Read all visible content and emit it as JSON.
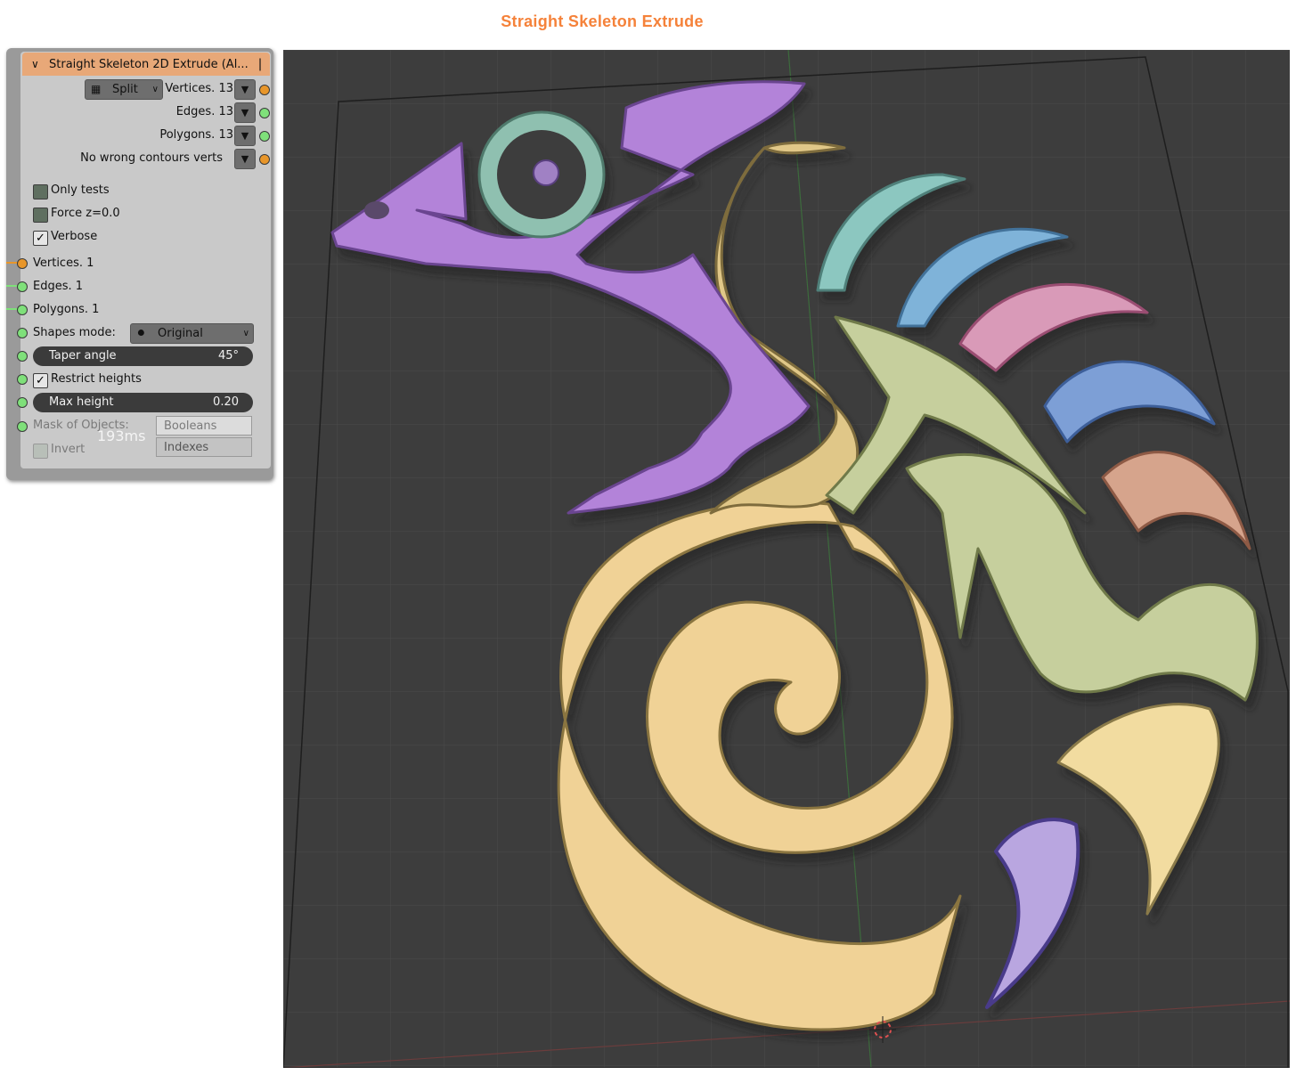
{
  "page": {
    "title": "Straight Skeleton Extrude",
    "title_color": "#f5823a"
  },
  "node": {
    "header_title": "Straight Skeleton 2D Extrude (Al...",
    "header_color": "#e8a878",
    "split_mode": "Split",
    "outputs": [
      {
        "label": "Vertices. 13",
        "socket_color": "#e8962a"
      },
      {
        "label": "Edges. 13",
        "socket_color": "#7fe07a"
      },
      {
        "label": "Polygons. 13",
        "socket_color": "#7fe07a"
      },
      {
        "label": "No wrong contours verts",
        "socket_color": "#e8962a"
      }
    ],
    "checkboxes": {
      "only_tests": {
        "label": "Only tests",
        "checked": false
      },
      "force_z": {
        "label": "Force z=0.0",
        "checked": false
      },
      "verbose": {
        "label": "Verbose",
        "checked": true
      }
    },
    "inputs": [
      {
        "label": "Vertices. 1",
        "socket_color": "#e8962a"
      },
      {
        "label": "Edges. 1",
        "socket_color": "#7fe07a"
      },
      {
        "label": "Polygons. 1",
        "socket_color": "#7fe07a"
      }
    ],
    "shapes_mode": {
      "label": "Shapes mode:",
      "value": "Original"
    },
    "taper_angle": {
      "label": "Taper angle",
      "value": "45°"
    },
    "restrict_heights": {
      "label": "Restrict heights",
      "checked": true
    },
    "max_height": {
      "label": "Max height",
      "value": "0.20"
    },
    "mask": {
      "label": "Mask of Objects:",
      "option_booleans": "Booleans",
      "option_indexes": "Indexes"
    },
    "invert": {
      "label": "Invert",
      "checked": false
    },
    "timing": "193ms"
  },
  "viewport": {
    "background": "#3d3d3d",
    "shapes": [
      {
        "name": "chameleon-head",
        "color": "#b383d9"
      },
      {
        "name": "eye-ring",
        "color": "#8fc0b0"
      },
      {
        "name": "body-spiral",
        "color": "#f0d296"
      },
      {
        "name": "leg-shape",
        "color": "#c6cf9d"
      },
      {
        "name": "crest-1",
        "color": "#8cc7c0"
      },
      {
        "name": "crest-2",
        "color": "#7fb3d9"
      },
      {
        "name": "crest-3",
        "color": "#d99ab8"
      },
      {
        "name": "crest-4",
        "color": "#7d9fd6"
      },
      {
        "name": "crest-5",
        "color": "#d6a48c"
      },
      {
        "name": "tail-drop",
        "color": "#f2dca0"
      },
      {
        "name": "claw-purple",
        "color": "#b9a6e0"
      }
    ]
  }
}
